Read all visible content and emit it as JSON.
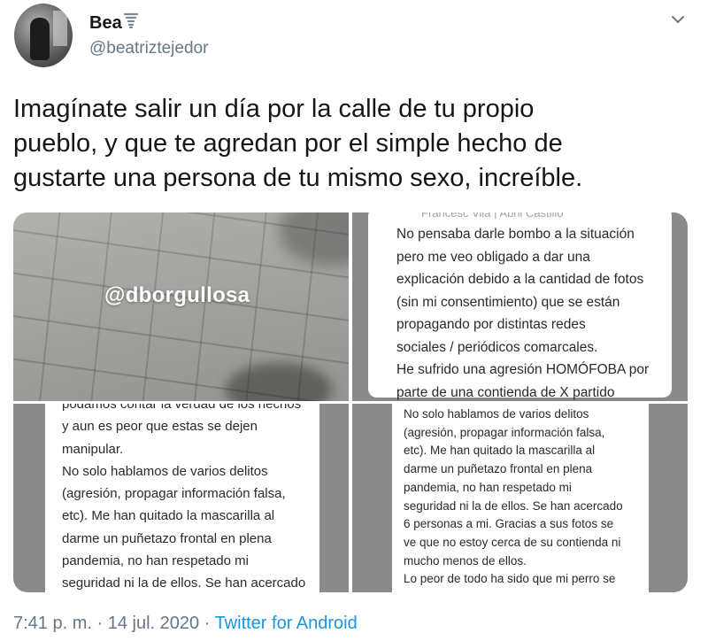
{
  "user": {
    "display_name": "Bea",
    "name_emoji_icon": "tornado-icon",
    "handle": "@beatriztejedor"
  },
  "tweet": {
    "lines": [
      "Imagínate salir un día por la calle de tu propio",
      "pueblo, y que te agredan por el simple hecho de",
      "gustarte una persona de tu mismo sexo, increíble."
    ]
  },
  "media": {
    "image1": {
      "watermark": "@dborgullosa"
    },
    "image2": {
      "faint_header": "Francesc Vila | Abril Castillo",
      "lines": [
        "No pensaba darle bombo a la situación",
        "pero me veo obligado a dar una",
        "explicación debido a la cantidad de fotos",
        "(sin mi consentimiento) que se están",
        "propagando por distintas redes",
        "sociales / periódicos comarcales.",
        "He sufrido una agresión HOMÓFOBA por",
        "parte de una contienda de X partido"
      ]
    },
    "image3": {
      "lines": [
        "podamos contar la verdad de los hechos",
        "y aun es peor que estas se dejen",
        "manipular.",
        "No solo hablamos de varios delitos",
        "(agresión, propagar información falsa,",
        "etc). Me han quitado la mascarilla al",
        "darme un puñetazo frontal en plena",
        "pandemia, no han respetado mi",
        "seguridad ni la de ellos. Se han acercado"
      ]
    },
    "image4": {
      "lines": [
        "No solo hablamos de varios delitos",
        "(agresión, propagar información falsa,",
        "etc). Me han quitado la mascarilla al",
        "darme un puñetazo frontal en plena",
        "pandemia, no han respetado mi",
        "seguridad ni la de ellos. Se han acercado",
        "6 personas a mi. Gracias a sus fotos se",
        "ve que no estoy cerca de su contienda ni",
        "mucho menos de ellos.",
        "Lo peor de todo ha sido que mi perro se"
      ]
    }
  },
  "meta": {
    "time": "7:41 p. m.",
    "sep1": " · ",
    "date": "14 jul. 2020",
    "sep2": " · ",
    "source": "Twitter for Android"
  },
  "colors": {
    "text": "#14171a",
    "secondary": "#657786",
    "link": "#1b95e0"
  },
  "icons": {
    "more_menu": "chevron-down-icon"
  }
}
